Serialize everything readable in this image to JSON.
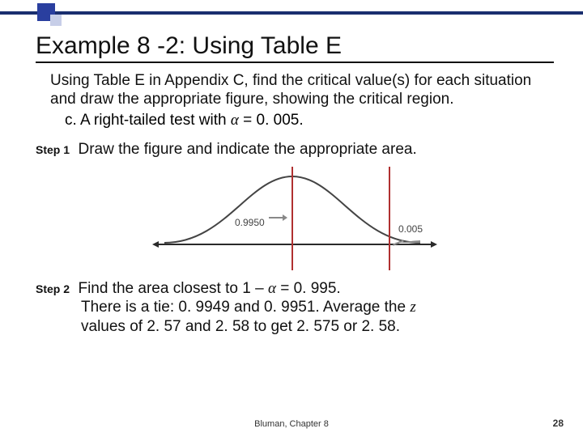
{
  "title": "Example 8 -2: Using Table E",
  "intro": "Using Table E in Appendix C, find the critical value(s) for each situation and draw the appropriate figure, showing the critical region.",
  "sub_c_prefix": "c. A right-tailed test with ",
  "alpha_sym": "α",
  "sub_c_suffix": " = 0. 005.",
  "step1": {
    "label": "Step 1",
    "text": "Draw the figure and indicate the appropriate area."
  },
  "figure": {
    "left_area": "0.9950",
    "right_area": "0.005"
  },
  "step2": {
    "label": "Step 2",
    "line1_a": "Find the area closest to 1 – ",
    "line1_b": " = 0. 995.",
    "line2_a": "There is a tie: 0. 9949 and 0. 9951.  Average the ",
    "z_sym": "z",
    "line3": "values of 2. 57 and 2. 58 to get 2. 575 or 2. 58."
  },
  "footer": "Bluman, Chapter 8",
  "page": "28",
  "chart_data": {
    "type": "area",
    "title": "Standard normal right-tailed critical region",
    "xlabel": "",
    "ylabel": "",
    "annotations": [
      "0.9950",
      "0.005"
    ],
    "series": [
      {
        "name": "left_area",
        "values": [
          0.995
        ]
      },
      {
        "name": "right_tail_area",
        "values": [
          0.005
        ]
      }
    ],
    "critical_value": 2.575,
    "alpha": 0.005
  }
}
